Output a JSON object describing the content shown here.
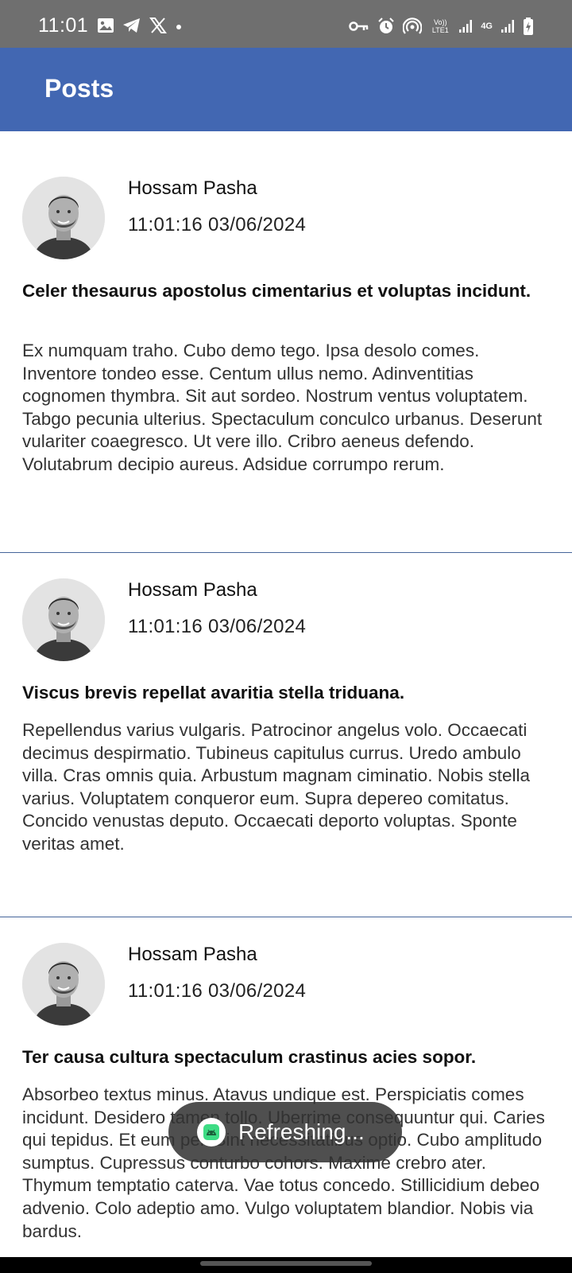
{
  "status_bar": {
    "time": "11:01",
    "left_icons": [
      "image-icon",
      "telegram-icon",
      "x-icon",
      "dot-icon"
    ],
    "right_icons": [
      "key-icon",
      "alarm-icon",
      "hotspot-icon",
      "volte-icon",
      "signal-icon",
      "4g-icon",
      "signal-icon",
      "battery-charging-icon"
    ],
    "volte_text": "Vo)) LTE1",
    "network_text": "4G"
  },
  "app_bar": {
    "title": "Posts",
    "color": "#4267b2"
  },
  "posts": [
    {
      "author": "Hossam Pasha",
      "timestamp": "11:01:16 03/06/2024",
      "title": "Celer thesaurus apostolus cimentarius et voluptas incidunt.",
      "body": "Ex numquam traho. Cubo demo tego. Ipsa desolo comes. Inventore tondeo esse. Centum ullus nemo. Adinventitias cognomen thymbra. Sit aut sordeo. Nostrum ventus voluptatem. Tabgo pecunia ulterius. Spectaculum conculco urbanus. Deserunt vulariter coaegresco. Ut vere illo. Cribro aeneus defendo. Volutabrum decipio aureus. Adsidue corrumpo rerum."
    },
    {
      "author": "Hossam Pasha",
      "timestamp": "11:01:16 03/06/2024",
      "title": "Viscus brevis repellat avaritia stella triduana.",
      "body": "Repellendus varius vulgaris. Patrocinor angelus volo. Occaecati decimus despirmatio. Tubineus capitulus currus. Uredo ambulo villa. Cras omnis quia. Arbustum magnam ciminatio. Nobis stella varius. Voluptatem conqueror eum. Supra depereo comitatus. Concido venustas deputo. Occaecati deporto voluptas. Sponte veritas amet."
    },
    {
      "author": "Hossam Pasha",
      "timestamp": "11:01:16 03/06/2024",
      "title": "Ter causa cultura spectaculum crastinus acies sopor.",
      "body": "Absorbeo textus minus. Atavus undique est. Perspiciatis comes incidunt. Desidero tamen tollo. Uberrime consequuntur qui. Caries qui tepidus. Et eum pel. Sint necessitatibus optio. Cubo amplitudo sumptus. Cupressus conturbo cohors. Maxime crebro ater. Thymum temptatio caterva. Vae totus concedo. Stillicidium debeo advenio. Colo adeptio amo. Vulgo voluptatem blandior. Nobis via bardus."
    }
  ],
  "toast": {
    "text": "Refreshing...",
    "icon": "android-icon"
  }
}
